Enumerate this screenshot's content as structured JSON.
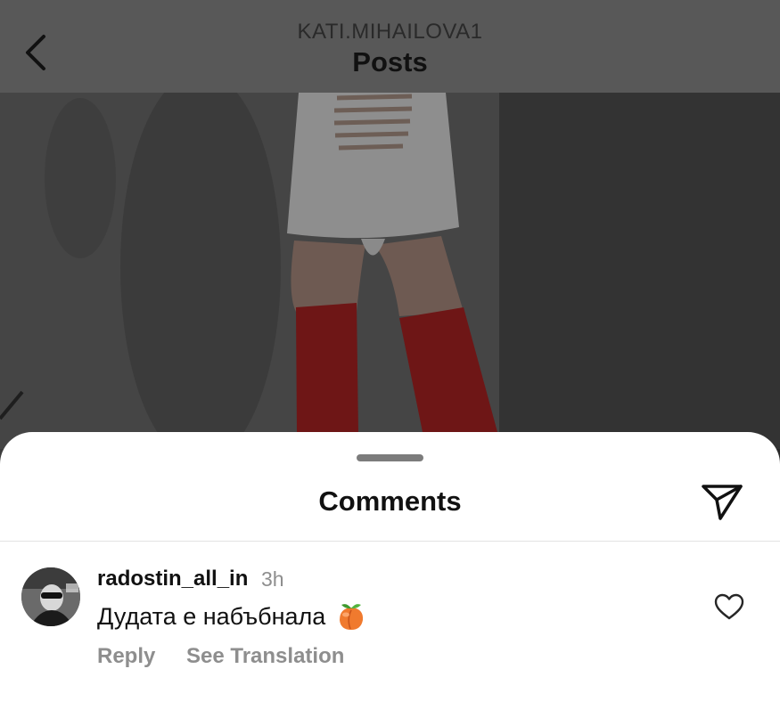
{
  "nav": {
    "username": "KATI.MIHAILOVA1",
    "title": "Posts"
  },
  "comments_sheet": {
    "title": "Comments",
    "comments": [
      {
        "username": "radostin_all_in",
        "time": "3h",
        "text": "Дудата е набъбнала",
        "emoji": "peach",
        "reply_label": "Reply",
        "translate_label": "See Translation"
      }
    ]
  },
  "icons": {
    "back": "chevron-left-icon",
    "share": "paper-plane-icon",
    "like": "heart-outline-icon",
    "emoji": "peach-emoji-icon"
  },
  "colors": {
    "nav_bg": "#585858",
    "sheet_bg": "#ffffff",
    "muted_text": "#8e8e8e",
    "boots": "#8a1a1a"
  }
}
